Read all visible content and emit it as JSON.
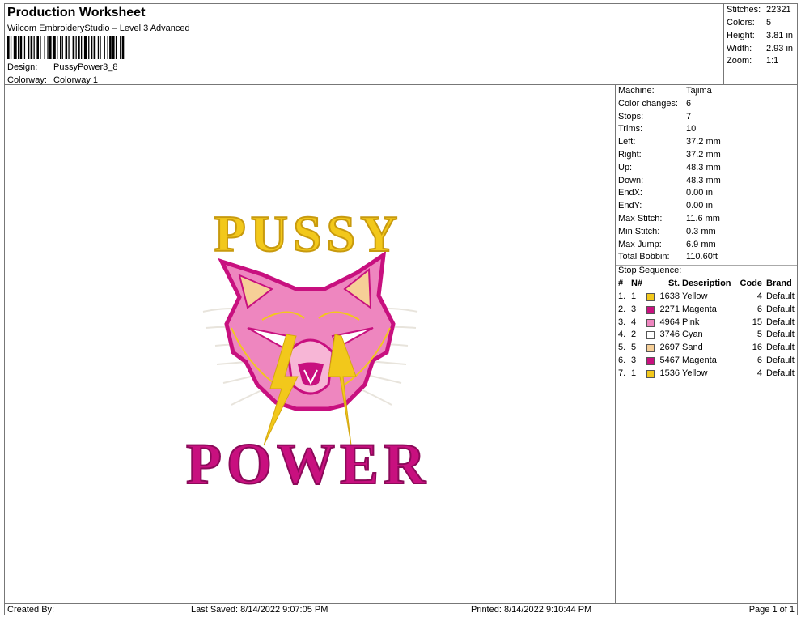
{
  "header": {
    "title": "Production Worksheet",
    "subtitle": "Wilcom EmbroideryStudio – Level 3 Advanced",
    "design_label": "Design:",
    "design_value": "PussyPower3_8",
    "colorway_label": "Colorway:",
    "colorway_value": "Colorway 1"
  },
  "summary": [
    {
      "label": "Stitches:",
      "value": "22321"
    },
    {
      "label": "Colors:",
      "value": "5"
    },
    {
      "label": "Height:",
      "value": "3.81 in"
    },
    {
      "label": "Width:",
      "value": "2.93 in"
    },
    {
      "label": "Zoom:",
      "value": "1:1"
    }
  ],
  "details": [
    {
      "label": "Machine:",
      "value": "Tajima"
    },
    {
      "label": "Color changes:",
      "value": "6"
    },
    {
      "label": "Stops:",
      "value": "7"
    },
    {
      "label": "Trims:",
      "value": "10"
    },
    {
      "label": "Left:",
      "value": "37.2 mm"
    },
    {
      "label": "Right:",
      "value": "37.2 mm"
    },
    {
      "label": "Up:",
      "value": "48.3 mm"
    },
    {
      "label": "Down:",
      "value": "48.3 mm"
    },
    {
      "label": "EndX:",
      "value": "0.00 in"
    },
    {
      "label": "EndY:",
      "value": "0.00 in"
    },
    {
      "label": "Max Stitch:",
      "value": "11.6 mm"
    },
    {
      "label": "Min Stitch:",
      "value": "0.3 mm"
    },
    {
      "label": "Max Jump:",
      "value": "6.9 mm"
    },
    {
      "label": "Total Bobbin:",
      "value": "110.60ft"
    }
  ],
  "stop_sequence": {
    "title": "Stop Sequence:",
    "headers": {
      "idx": "#",
      "n": "N#",
      "st": "St.",
      "desc": "Description",
      "code": "Code",
      "brand": "Brand"
    },
    "rows": [
      {
        "idx": "1.",
        "n": "1",
        "color": "#f2c81b",
        "st": "1638",
        "desc": "Yellow",
        "code": "4",
        "brand": "Default"
      },
      {
        "idx": "2.",
        "n": "3",
        "color": "#c8107f",
        "st": "2271",
        "desc": "Magenta",
        "code": "6",
        "brand": "Default"
      },
      {
        "idx": "3.",
        "n": "4",
        "color": "#ee86bf",
        "st": "4964",
        "desc": "Pink",
        "code": "15",
        "brand": "Default"
      },
      {
        "idx": "4.",
        "n": "2",
        "color": "#ffffff",
        "st": "3746",
        "desc": "Cyan",
        "code": "5",
        "brand": "Default"
      },
      {
        "idx": "5.",
        "n": "5",
        "color": "#f6cf97",
        "st": "2697",
        "desc": "Sand",
        "code": "16",
        "brand": "Default"
      },
      {
        "idx": "6.",
        "n": "3",
        "color": "#c8107f",
        "st": "5467",
        "desc": "Magenta",
        "code": "6",
        "brand": "Default"
      },
      {
        "idx": "7.",
        "n": "1",
        "color": "#f2c81b",
        "st": "1536",
        "desc": "Yellow",
        "code": "4",
        "brand": "Default"
      }
    ]
  },
  "design_art": {
    "top_text": "PUSSY",
    "bottom_text": "POWER",
    "colors": {
      "yellow": "#f2c81b",
      "magenta": "#c8107f",
      "pink": "#ee86bf",
      "sand": "#f6cf97",
      "white": "#ffffff"
    }
  },
  "footer": {
    "created": "Created By:",
    "last_saved": "Last Saved: 8/14/2022 9:07:05 PM",
    "printed": "Printed: 8/14/2022 9:10:44 PM",
    "page": "Page 1 of 1"
  }
}
